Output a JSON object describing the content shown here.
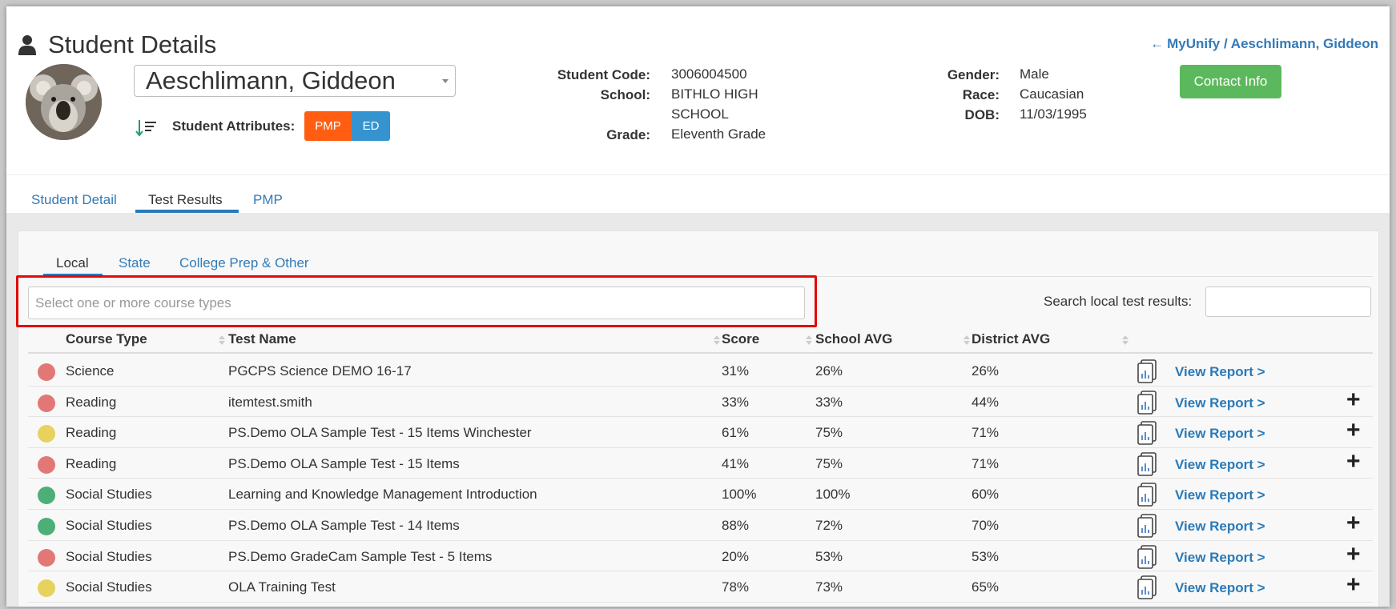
{
  "header": {
    "title": "Student Details",
    "breadcrumb": "MyUnify / Aeschlimann, Giddeon",
    "student_name": "Aeschlimann, Giddeon",
    "attributes_label": "Student Attributes:",
    "attributes": [
      "PMP",
      "ED"
    ],
    "contact_button": "Contact Info",
    "colors": {
      "pmp": "#ff5e12",
      "ed": "#3593d0",
      "contact": "#5cb85c",
      "link": "#337ab7"
    }
  },
  "info": {
    "student_code_label": "Student Code:",
    "student_code": "3006004500",
    "school_label": "School:",
    "school_line1": "BITHLO HIGH",
    "school_line2": "SCHOOL",
    "grade_label": "Grade:",
    "grade": "Eleventh Grade",
    "gender_label": "Gender:",
    "gender": "Male",
    "race_label": "Race:",
    "race": "Caucasian",
    "dob_label": "DOB:",
    "dob": "11/03/1995"
  },
  "tabs": [
    "Student Detail",
    "Test Results",
    "PMP"
  ],
  "active_tab": "Test Results",
  "subtabs": [
    "Local",
    "State",
    "College Prep & Other"
  ],
  "active_subtab": "Local",
  "filter": {
    "course_placeholder": "Select one or more course types",
    "search_label": "Search local test results:",
    "search_value": ""
  },
  "table": {
    "columns": [
      "Course Type",
      "Test Name",
      "Score",
      "School AVG",
      "District AVG"
    ],
    "view_label": "View Report >",
    "status_colors": {
      "red": "#e27876",
      "yellow": "#e8d25e",
      "green": "#4caf78"
    },
    "rows": [
      {
        "status": "red",
        "course": "Science",
        "test": "PGCPS Science DEMO 16-17",
        "score": "31%",
        "school_avg": "26%",
        "district_avg": "26%",
        "plus": false
      },
      {
        "status": "red",
        "course": "Reading",
        "test": "itemtest.smith",
        "score": "33%",
        "school_avg": "33%",
        "district_avg": "44%",
        "plus": true
      },
      {
        "status": "yellow",
        "course": "Reading",
        "test": "PS.Demo OLA Sample Test - 15 Items Winchester",
        "score": "61%",
        "school_avg": "75%",
        "district_avg": "71%",
        "plus": true
      },
      {
        "status": "red",
        "course": "Reading",
        "test": "PS.Demo OLA Sample Test - 15 Items",
        "score": "41%",
        "school_avg": "75%",
        "district_avg": "71%",
        "plus": true
      },
      {
        "status": "green",
        "course": "Social Studies",
        "test": "Learning and Knowledge Management Introduction",
        "score": "100%",
        "school_avg": "100%",
        "district_avg": "60%",
        "plus": false
      },
      {
        "status": "green",
        "course": "Social Studies",
        "test": "PS.Demo OLA Sample Test - 14 Items",
        "score": "88%",
        "school_avg": "72%",
        "district_avg": "70%",
        "plus": true
      },
      {
        "status": "red",
        "course": "Social Studies",
        "test": "PS.Demo GradeCam Sample Test - 5 Items",
        "score": "20%",
        "school_avg": "53%",
        "district_avg": "53%",
        "plus": true
      },
      {
        "status": "yellow",
        "course": "Social Studies",
        "test": "OLA Training Test",
        "score": "78%",
        "school_avg": "73%",
        "district_avg": "65%",
        "plus": true
      }
    ]
  }
}
